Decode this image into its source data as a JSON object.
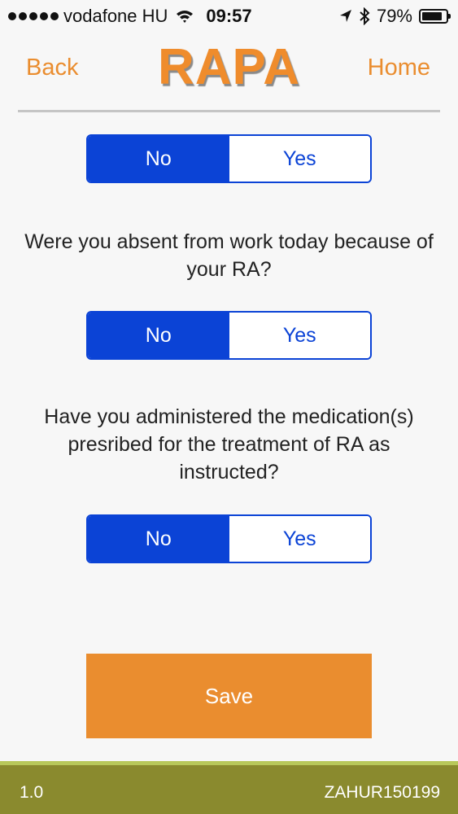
{
  "status_bar": {
    "carrier": "vodafone HU",
    "time": "09:57",
    "battery": "79%",
    "icons": [
      "signal-dots-icon",
      "wifi-icon",
      "location-arrow-icon",
      "bluetooth-icon",
      "battery-icon"
    ]
  },
  "nav": {
    "back_label": "Back",
    "title": "RAPA",
    "home_label": "Home"
  },
  "questions": [
    {
      "text": "",
      "no_label": "No",
      "yes_label": "Yes",
      "selected": "No"
    },
    {
      "text": "Were you absent from work today because of your RA?",
      "no_label": "No",
      "yes_label": "Yes",
      "selected": "No"
    },
    {
      "text": "Have you administered the medication(s) presribed for the treatment of RA as instructed?",
      "no_label": "No",
      "yes_label": "Yes",
      "selected": "No"
    }
  ],
  "save_label": "Save",
  "footer": {
    "version": "1.0",
    "user_id": "ZAHUR150199"
  },
  "colors": {
    "accent_orange": "#ea8d2f",
    "segment_blue": "#0b43d6",
    "footer_olive": "#8a8a2e"
  }
}
